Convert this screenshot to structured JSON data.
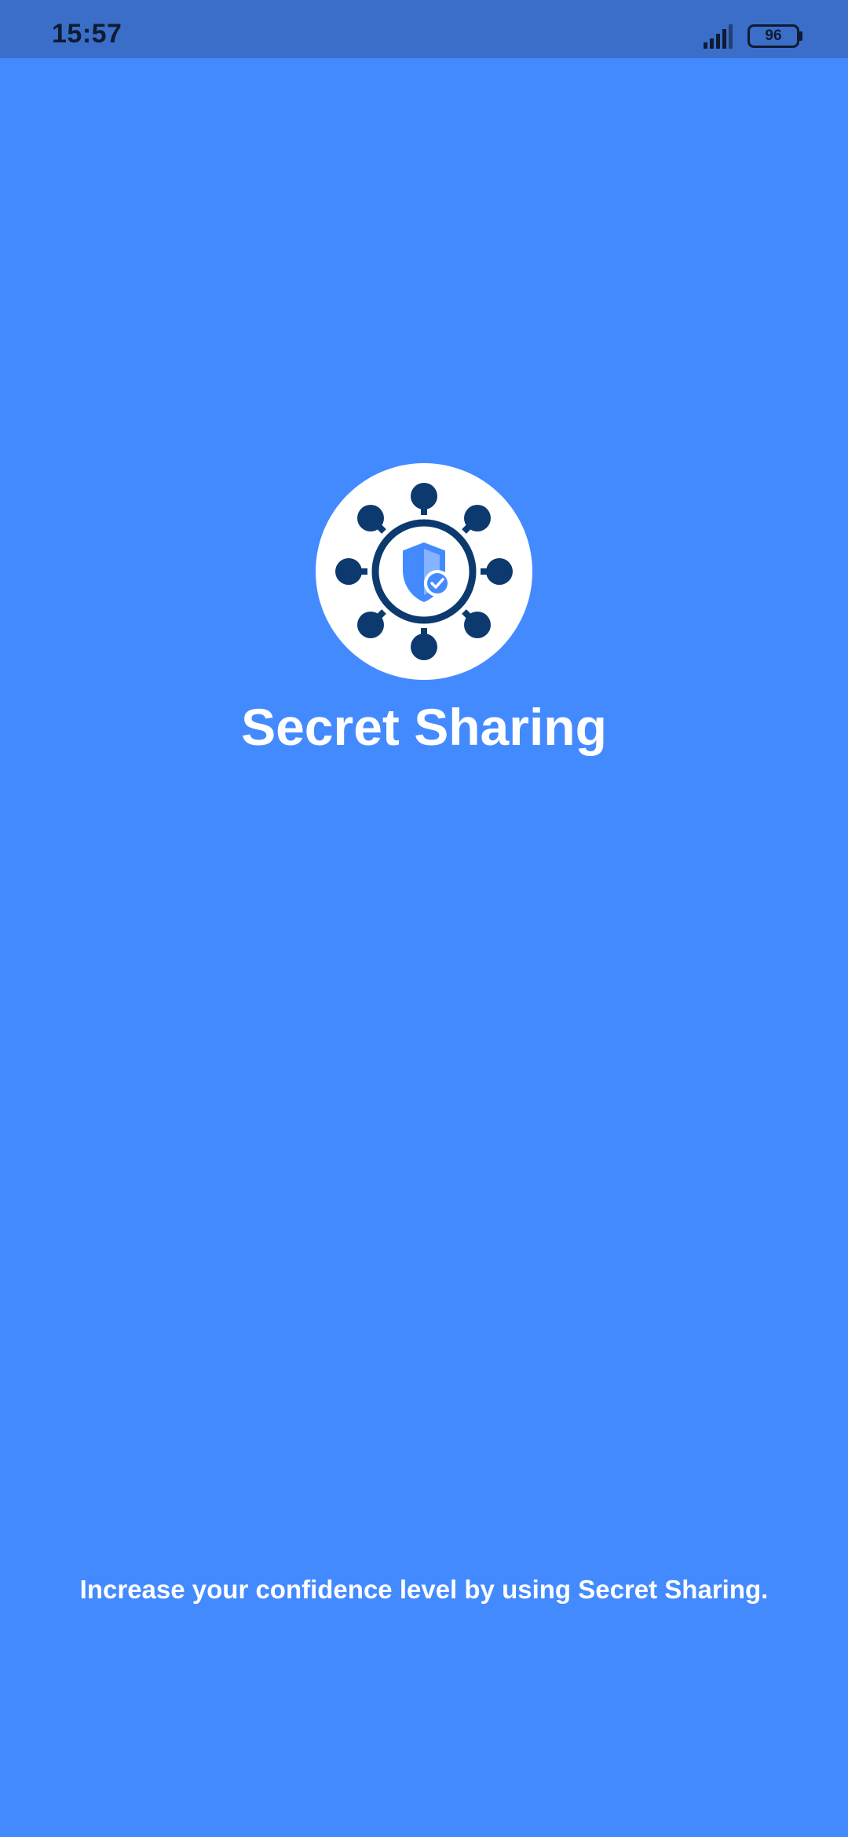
{
  "status_bar": {
    "time": "15:57",
    "battery_level": "96",
    "signal_icon": "cellular-signal-icon"
  },
  "splash": {
    "logo_icon": "network-shield-check-icon",
    "app_title": "Secret Sharing",
    "tagline": "Increase your confidence level by using Secret Sharing."
  },
  "colors": {
    "background": "#448aff",
    "status_bar": "#3a6ec8",
    "logo_dark": "#0d3a6e",
    "text": "#ffffff"
  }
}
